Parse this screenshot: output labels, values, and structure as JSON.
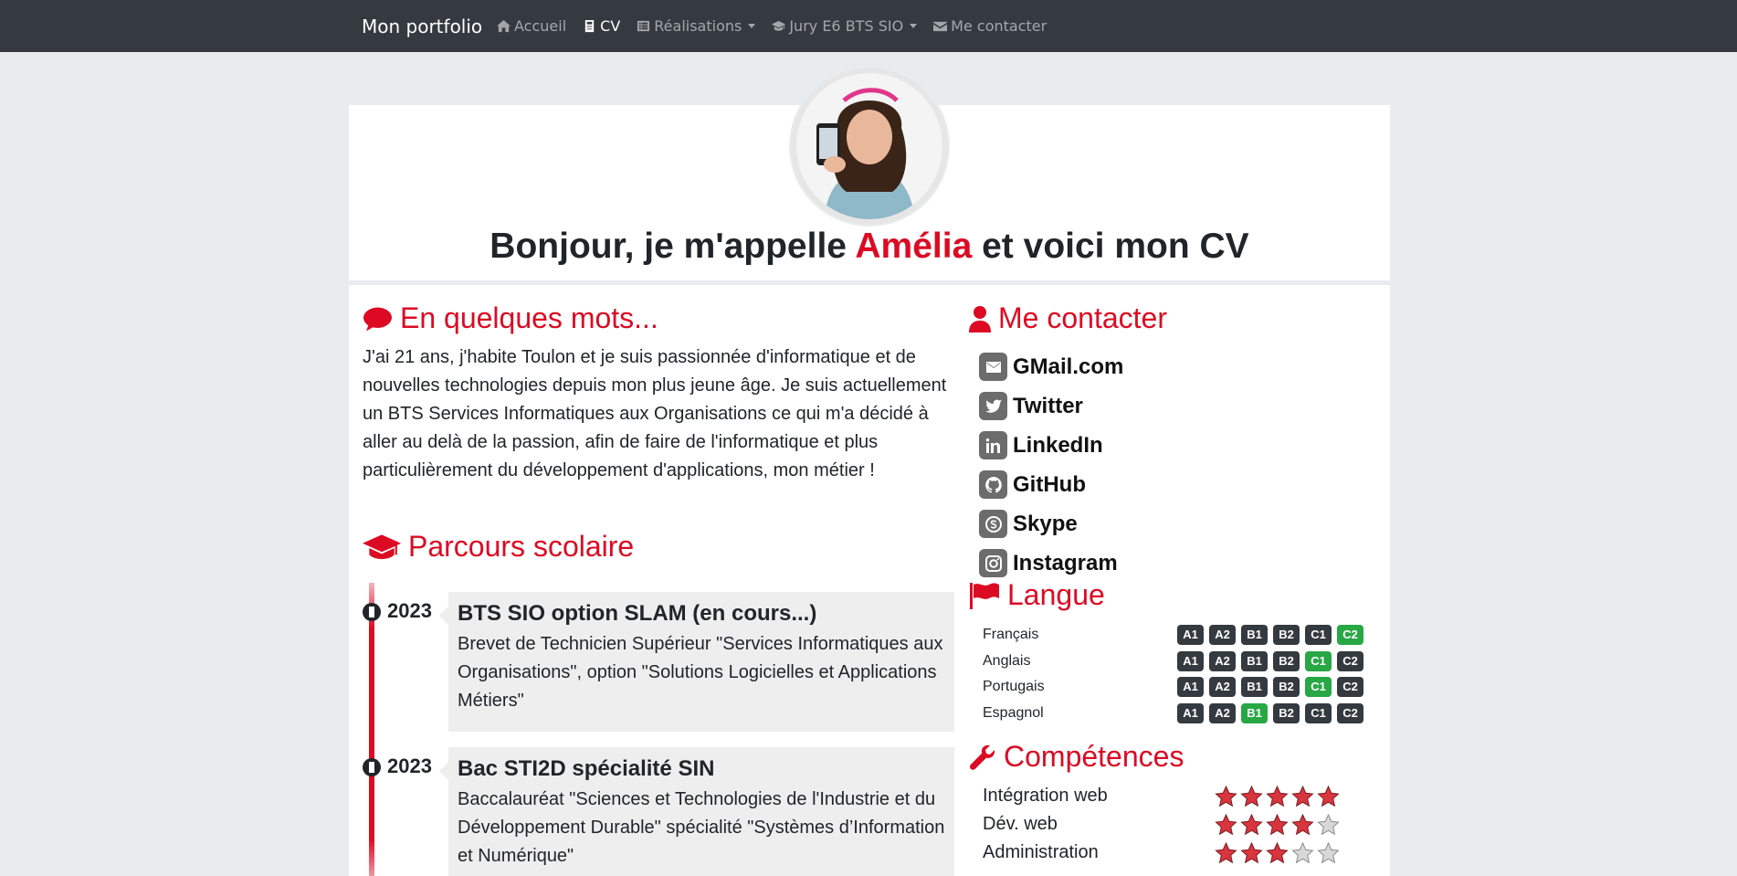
{
  "navbar": {
    "brand": "Mon portfolio",
    "links": [
      {
        "label": "Accueil",
        "icon": "home-icon"
      },
      {
        "label": "CV",
        "icon": "id-badge-icon",
        "active": true
      },
      {
        "label": "Réalisations",
        "icon": "list-alt-icon",
        "dropdown": true
      },
      {
        "label": "Jury E6 BTS SIO",
        "icon": "graduation-cap-icon",
        "dropdown": true
      },
      {
        "label": "Me contacter",
        "icon": "envelope-icon"
      }
    ]
  },
  "header": {
    "title_prefix": "Bonjour, je m'appelle ",
    "name": "Amélia",
    "title_suffix": " et voici mon CV"
  },
  "about": {
    "heading": "En quelques mots...",
    "text": "J'ai 21 ans, j'habite Toulon et je suis passionnée d'informatique et de nouvelles technologies depuis mon plus jeune âge. Je suis actuellement un BTS Services Informatiques aux Organisations ce qui m'a décidé à aller au delà de la passion, afin de faire de l'informatique et plus particulièrement du développement d'applications, mon métier !"
  },
  "education": {
    "heading": "Parcours scolaire",
    "items": [
      {
        "year": "2023",
        "title": "BTS SIO option SLAM (en cours...)",
        "desc": "Brevet de Technicien Supérieur \"Services Informatiques aux Organisations\", option \"Solutions Logicielles et Applications Métiers\""
      },
      {
        "year": "2023",
        "title": "Bac STI2D spécialité SIN",
        "desc": "Baccalauréat \"Sciences et Technologies de l'Industrie et du Développement Durable\" spécialité \"Systèmes d’Information et Numérique\""
      }
    ]
  },
  "contact": {
    "heading": "Me contacter",
    "items": [
      "GMail.com",
      "Twitter",
      "LinkedIn",
      "GitHub",
      "Skype",
      "Instagram"
    ]
  },
  "languages": {
    "heading": "Langue",
    "levels": [
      "A1",
      "A2",
      "B1",
      "B2",
      "C1",
      "C2"
    ],
    "items": [
      {
        "name": "Français",
        "level": "C2"
      },
      {
        "name": "Anglais",
        "level": "C1"
      },
      {
        "name": "Portugais",
        "level": "C1"
      },
      {
        "name": "Espagnol",
        "level": "B1"
      }
    ]
  },
  "skills": {
    "heading": "Compétences",
    "items": [
      {
        "name": "Intégration web",
        "rating": 5,
        "max": 5
      },
      {
        "name": "Dév. web",
        "rating": 4,
        "max": 5
      },
      {
        "name": "Administration",
        "rating": 3,
        "max": 5
      }
    ]
  },
  "colors": {
    "accent": "#dc0a23",
    "navbar": "#343a40",
    "badge_active": "#28a745",
    "badge": "#343a40"
  }
}
